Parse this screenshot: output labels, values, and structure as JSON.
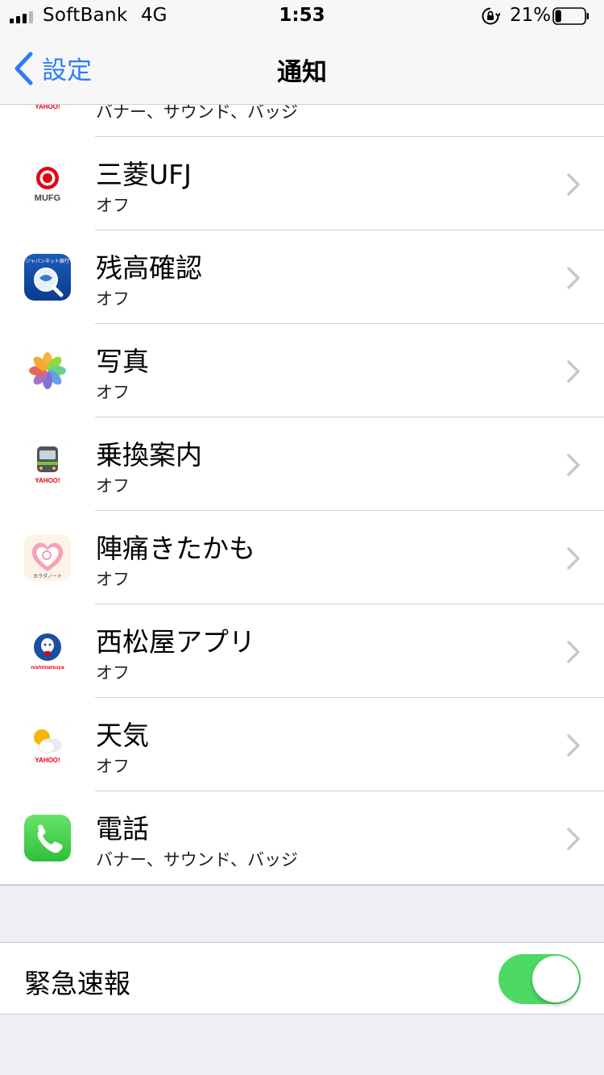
{
  "status_bar": {
    "carrier": "SoftBank",
    "network": "4G",
    "time": "1:53",
    "battery_percent": "21%",
    "battery_level": 0.21
  },
  "nav": {
    "back_label": "設定",
    "title": "通知"
  },
  "partial_row": {
    "subtitle": "バナー、サウンド、バッジ",
    "icon": "yahoo-app-icon"
  },
  "apps": [
    {
      "name": "三菱UFJ",
      "status": "オフ",
      "icon": "mufg-app-icon",
      "icon_label": "MUFG"
    },
    {
      "name": "残高確認",
      "status": "オフ",
      "icon": "zandaka-app-icon",
      "icon_label": "ジャパンネット銀行"
    },
    {
      "name": "写真",
      "status": "オフ",
      "icon": "photos-app-icon"
    },
    {
      "name": "乗換案内",
      "status": "オフ",
      "icon": "train-app-icon",
      "icon_label": "YAHOO!"
    },
    {
      "name": "陣痛きたかも",
      "status": "オフ",
      "icon": "jintsu-app-icon",
      "icon_label": "カラダノート"
    },
    {
      "name": "西松屋アプリ",
      "status": "オフ",
      "icon": "nishimatsuya-app-icon",
      "icon_label": "nishimatsuya"
    },
    {
      "name": "天気",
      "status": "オフ",
      "icon": "weather-app-icon",
      "icon_label": "YAHOO!"
    },
    {
      "name": "電話",
      "status": "バナー、サウンド、バッジ",
      "icon": "phone-app-icon"
    }
  ],
  "emergency": {
    "label": "緊急速報",
    "enabled": true
  },
  "colors": {
    "accent": "#2f7cf6",
    "toggle_on": "#4cd964",
    "background": "#efeff4"
  }
}
